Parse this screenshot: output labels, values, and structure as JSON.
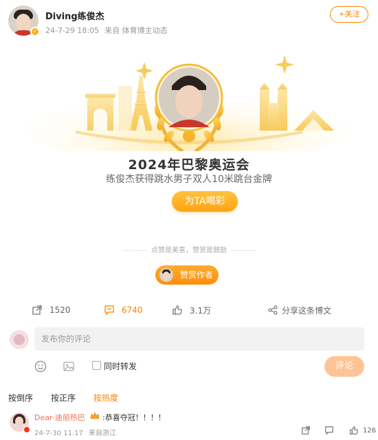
{
  "post": {
    "author": "Diving练俊杰",
    "time": "24-7-29 18:05",
    "source": "来自 体育博主动态",
    "follow_label": "+关注"
  },
  "card": {
    "title": "2024年巴黎奥运会",
    "subtitle": "练俊杰获得跳水男子双人10米跳台金牌",
    "cheer_label": "为TA喝彩"
  },
  "reward": {
    "tip": "点赞是美意，赞赏是鼓励",
    "button_label": "赞赏作者"
  },
  "actions": {
    "repost_count": "1520",
    "comment_count": "6740",
    "like_count": "3.1万",
    "share_label": "分享这条博文"
  },
  "comment_box": {
    "placeholder": "发布你的评论",
    "repost_label": "同时转发",
    "submit_label": "评论"
  },
  "sort": {
    "tabs": [
      "按倒序",
      "按正序",
      "按热度"
    ],
    "active": "按热度"
  },
  "comments": [
    {
      "name": "Dear-迪丽热巴",
      "text": ":恭喜夺冠！！！！",
      "time": "24-7-30 11:17",
      "location": "来自浙江",
      "likes": "126"
    }
  ],
  "colors": {
    "accent": "#ff8200",
    "gold": "#f5b21b",
    "cheer_button": "#ffa414"
  }
}
